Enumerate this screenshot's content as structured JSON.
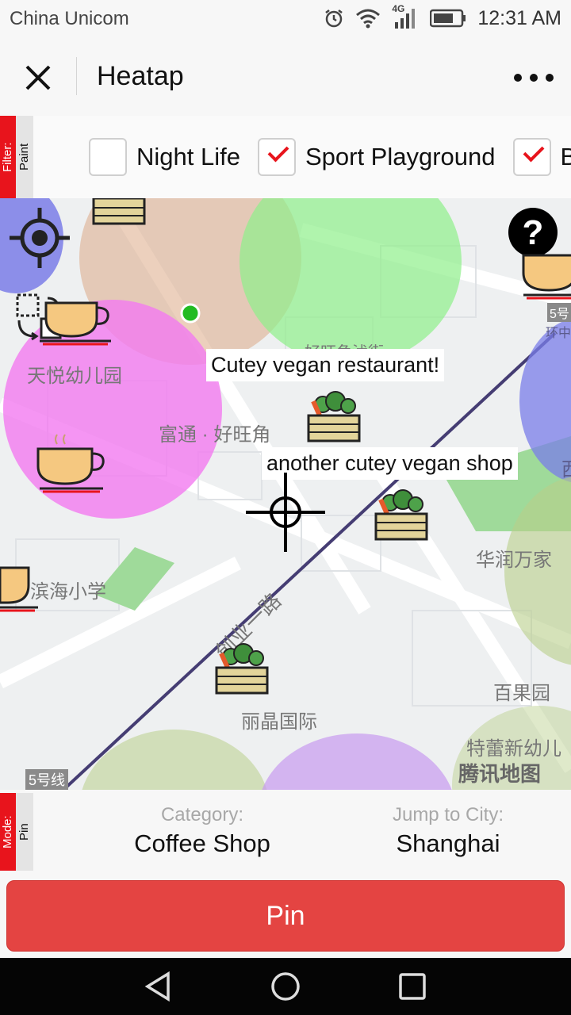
{
  "status": {
    "carrier": "China Unicom",
    "network": "4G",
    "time": "12:31 AM"
  },
  "titlebar": {
    "title": "Heatap"
  },
  "filter": {
    "tab": {
      "label": "Filter:",
      "value": "Paint"
    },
    "items": [
      {
        "label": "Night Life",
        "checked": false
      },
      {
        "label": "Sport Playground",
        "checked": true
      },
      {
        "label": "B",
        "checked": true
      }
    ]
  },
  "map": {
    "labels": {
      "restaurant": "Cutey vegan restaurant!",
      "shop": "another cutey vegan shop"
    },
    "streets": {
      "kindergarten1": "天悦幼儿园",
      "fuTong": "富通 · 好旺角",
      "binhai": "滨海小学",
      "road": "创业一路",
      "huarun": "华润万家",
      "baiguo": "百果园",
      "lijing": "丽晶国际",
      "telei": "特蕾新幼儿",
      "metro": "5号线",
      "metro2": "5号",
      "huanzhong": "环中",
      "partial1": "好旺角沭街",
      "west": "西",
      "watermark": "腾讯地图"
    },
    "colors": {
      "blue": "#7a7de8",
      "peach": "#dca987",
      "green": "#8ef08a",
      "pink": "#f27af0",
      "olive": "#b9cf8a",
      "purple": "#c79af0"
    },
    "icons": [
      "crosshair-icon",
      "help-icon",
      "coffee-cup-icon",
      "vegetable-crate-icon",
      "lasso-select-icon",
      "location-dot-icon"
    ]
  },
  "bottom": {
    "mode": {
      "label": "Mode:",
      "value": "Pin"
    },
    "category": {
      "caption": "Category:",
      "value": "Coffee Shop"
    },
    "city": {
      "caption": "Jump to City:",
      "value": "Shanghai"
    }
  },
  "action": {
    "pin_label": "Pin"
  }
}
